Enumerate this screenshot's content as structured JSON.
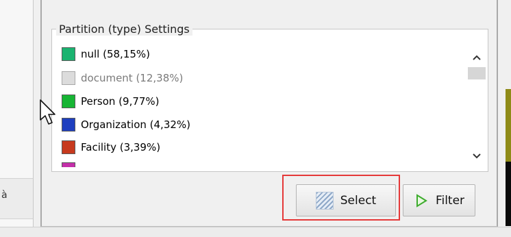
{
  "partition_group": {
    "title": "Partition (type) Settings",
    "items": [
      {
        "label": "null (58,15%)",
        "color": "#1ab370",
        "enabled": true
      },
      {
        "label": "document (12,38%)",
        "color": "#dcdcdc",
        "enabled": false
      },
      {
        "label": "Person (9,77%)",
        "color": "#17b534",
        "enabled": true
      },
      {
        "label": "Organization (4,32%)",
        "color": "#1e3fbf",
        "enabled": true
      },
      {
        "label": "Facility (3,39%)",
        "color": "#c73a1e",
        "enabled": true
      },
      {
        "label": "",
        "color": "#c42fa9",
        "enabled": true
      }
    ]
  },
  "scrollbar": {
    "up_icon": "chevron-up-icon",
    "down_icon": "chevron-down-icon"
  },
  "buttons": {
    "select_label": "Select",
    "filter_label": "Filter"
  },
  "left_pane": {
    "tab_glyph": "à"
  },
  "colors": {
    "highlight": "#e53838"
  }
}
